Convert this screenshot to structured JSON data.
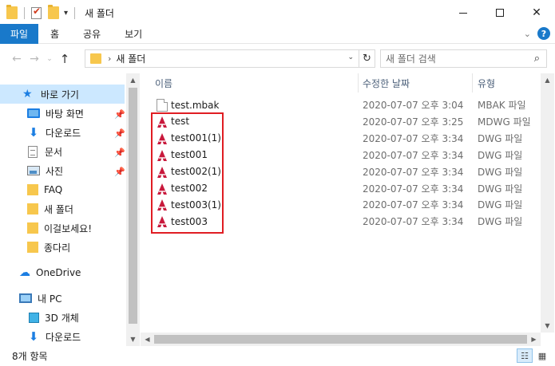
{
  "window": {
    "title": "새 폴더"
  },
  "ribbon": {
    "tabs": [
      "파일",
      "홈",
      "공유",
      "보기"
    ]
  },
  "address": {
    "path": "새 폴더",
    "search_placeholder": "새 폴더 검색"
  },
  "nav": {
    "quick_access": "바로 가기",
    "items": [
      {
        "label": "바탕 화면",
        "icon": "desktop-icon",
        "pinned": true
      },
      {
        "label": "다운로드",
        "icon": "download-icon",
        "pinned": true
      },
      {
        "label": "문서",
        "icon": "document-icon",
        "pinned": true
      },
      {
        "label": "사진",
        "icon": "pictures-icon",
        "pinned": true
      },
      {
        "label": "FAQ",
        "icon": "folder-icon",
        "pinned": false
      },
      {
        "label": "새 폴더",
        "icon": "folder-icon",
        "pinned": false
      },
      {
        "label": "이걸보세요!",
        "icon": "folder-icon",
        "pinned": false
      },
      {
        "label": "종다리",
        "icon": "folder-icon",
        "pinned": false
      }
    ],
    "onedrive": "OneDrive",
    "this_pc": "내 PC",
    "pc_items": [
      {
        "label": "3D 개체",
        "icon": "3d-objects-icon"
      },
      {
        "label": "다운로드",
        "icon": "download-icon"
      }
    ]
  },
  "columns": {
    "name": "이름",
    "date": "수정한 날짜",
    "type": "유형"
  },
  "files": [
    {
      "name": "test.mbak",
      "date": "2020-07-07 오후 3:04",
      "type": "MBAK 파일",
      "kind": "text"
    },
    {
      "name": "test",
      "date": "2020-07-07 오후 3:25",
      "type": "MDWG 파일",
      "kind": "dwg"
    },
    {
      "name": "test001(1)",
      "date": "2020-07-07 오후 3:34",
      "type": "DWG 파일",
      "kind": "dwg"
    },
    {
      "name": "test001",
      "date": "2020-07-07 오후 3:34",
      "type": "DWG 파일",
      "kind": "dwg"
    },
    {
      "name": "test002(1)",
      "date": "2020-07-07 오후 3:34",
      "type": "DWG 파일",
      "kind": "dwg"
    },
    {
      "name": "test002",
      "date": "2020-07-07 오후 3:34",
      "type": "DWG 파일",
      "kind": "dwg"
    },
    {
      "name": "test003(1)",
      "date": "2020-07-07 오후 3:34",
      "type": "DWG 파일",
      "kind": "dwg"
    },
    {
      "name": "test003",
      "date": "2020-07-07 오후 3:34",
      "type": "DWG 파일",
      "kind": "dwg"
    }
  ],
  "status": {
    "count_text": "8개 항목"
  },
  "colors": {
    "accent": "#1979ca",
    "selection": "#cce8ff",
    "dwg_icon": "#c8193c",
    "highlight_box": "#e01d23"
  }
}
